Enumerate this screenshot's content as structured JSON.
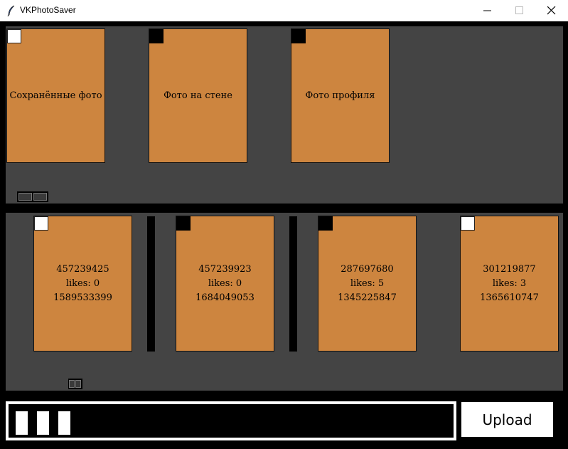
{
  "window": {
    "title": "VKPhotoSaver"
  },
  "albums": [
    {
      "label": "Сохранённые фото",
      "selected": true
    },
    {
      "label": "Фото на стене",
      "selected": false
    },
    {
      "label": "Фото профиля",
      "selected": false
    }
  ],
  "photos": [
    {
      "id": "457239425",
      "likes": "likes: 0",
      "date": "1589533399",
      "selected": true
    },
    {
      "id": "457239923",
      "likes": "likes: 0",
      "date": "1684049053",
      "selected": false
    },
    {
      "id": "287697680",
      "likes": "likes: 5",
      "date": "1345225847",
      "selected": false
    },
    {
      "id": "301219877",
      "likes": "likes: 3",
      "date": "1365610747",
      "selected": true
    }
  ],
  "upload": {
    "button_label": "Upload",
    "progress_blocks_filled": 3
  },
  "colors": {
    "card": "#cd853f",
    "panel": "#444444",
    "background": "#000000"
  }
}
